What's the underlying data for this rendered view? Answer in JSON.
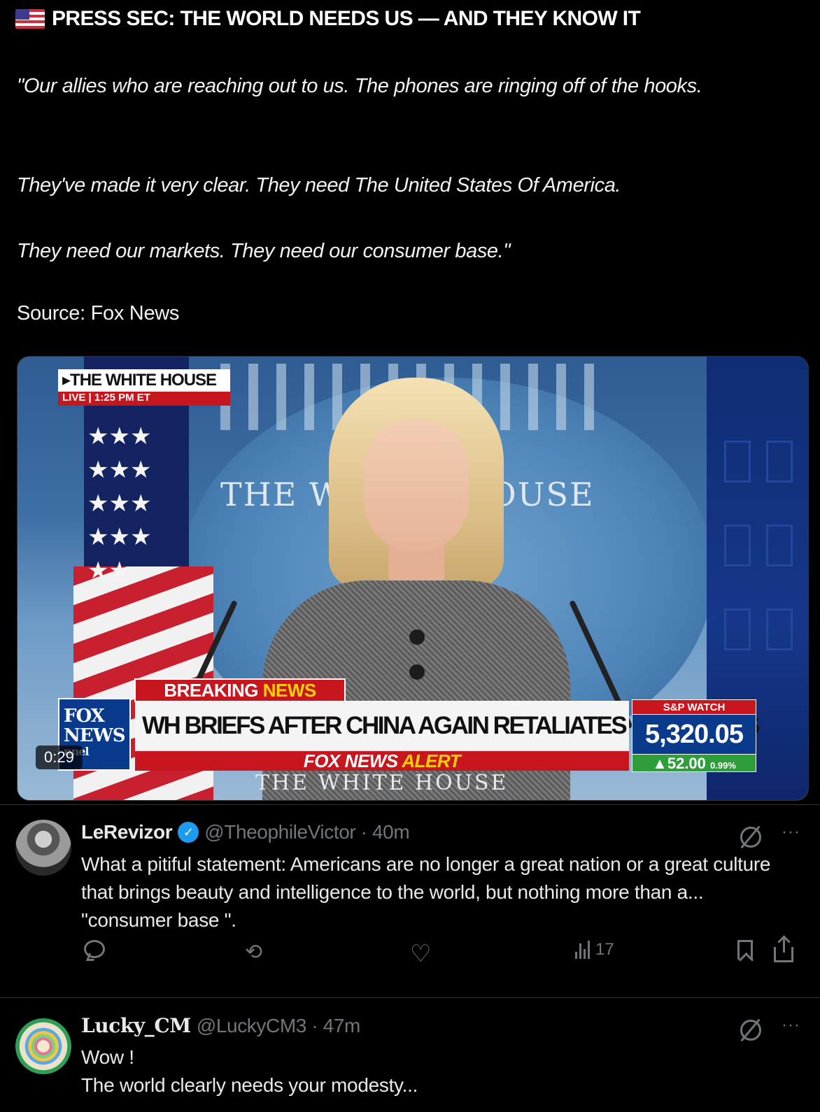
{
  "post": {
    "flag_icon": "us-flag-emoji",
    "headline": "PRESS SEC: THE WORLD NEEDS US — AND THEY KNOW IT",
    "quote_line_1": "\"Our allies who are reaching out to us. The phones are ringing off of the hooks.",
    "quote_line_2": "They've made it very clear. They need The United States Of America.",
    "quote_line_3": "They need our markets. They need our consumer base.\"",
    "source": "Source: Fox News"
  },
  "video": {
    "duration": "0:29",
    "wh_tag": "THE WHITE HOUSE",
    "wh_live": "LIVE",
    "wh_time": "1:25 PM ET",
    "seal_text_left": "THE W",
    "seal_text_right": "OUSE",
    "breaking": "BREAKING",
    "breaking_news": "NEWS",
    "fox_logo_1": "FOX",
    "fox_logo_2": "NEWS",
    "fox_logo_3": "nnel",
    "chyron": "WH BRIEFS AFTER CHINA AGAIN RETALIATES ON TARIFFS",
    "alert_prefix": "FOX NEWS",
    "alert_word": "ALERT",
    "bottom_text": "THE WHITE HOUSE",
    "sp_label": "S&P WATCH",
    "sp_value": "5,320.05",
    "sp_change": "▲52.00",
    "sp_pct": "0.99%"
  },
  "replies": [
    {
      "name": "LeRevizor",
      "verified": true,
      "handle": "@TheophileVictor · 40m",
      "text": "What a pitiful statement: Americans are no longer a great nation or a great culture that brings beauty and intelligence to the world, but nothing more than a... \"consumer base \".",
      "views": "17",
      "more": "···"
    },
    {
      "name": "Lucky_CM",
      "verified": false,
      "handle": "@LuckyCM3 · 47m",
      "text_line_1": "Wow !",
      "text_line_2": "The world clearly needs your modesty...",
      "more": "···"
    }
  ],
  "colors": {
    "background": "#000000",
    "text": "#e7e9ea",
    "muted": "#71767b",
    "verified": "#1d9bf0",
    "fox_red": "#c8161e",
    "fox_blue": "#0a3a8c"
  }
}
